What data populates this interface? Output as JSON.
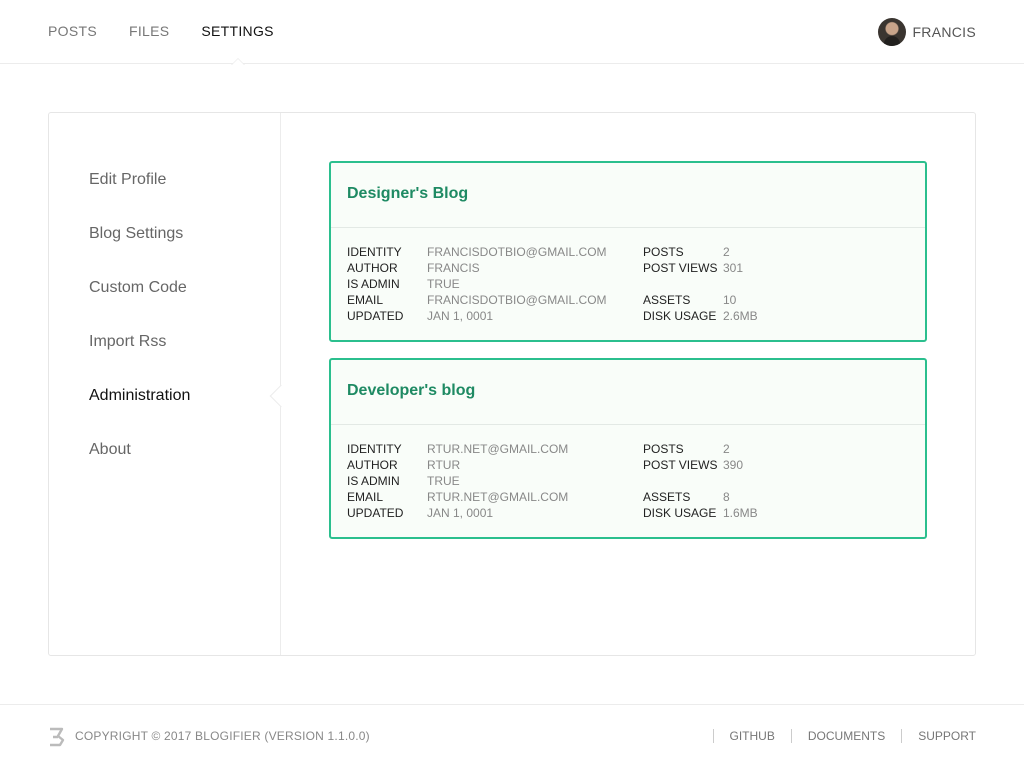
{
  "nav": {
    "items": [
      {
        "label": "POSTS"
      },
      {
        "label": "FILES"
      },
      {
        "label": "SETTINGS"
      }
    ],
    "active": "SETTINGS"
  },
  "user": {
    "name": "FRANCIS",
    "avatar_icon": "user-avatar-photo"
  },
  "sidebar": {
    "items": [
      {
        "label": "Edit Profile"
      },
      {
        "label": "Blog Settings"
      },
      {
        "label": "Custom Code"
      },
      {
        "label": "Import Rss"
      },
      {
        "label": "Administration"
      },
      {
        "label": "About"
      }
    ],
    "active": "Administration"
  },
  "blogs": [
    {
      "title": "Designer's Blog",
      "identity_label": "IDENTITY",
      "identity": "FRANCISDOTBIO@GMAIL.COM",
      "author_label": "AUTHOR",
      "author": "FRANCIS",
      "is_admin_label": "IS ADMIN",
      "is_admin": "TRUE",
      "email_label": "EMAIL",
      "email": "FRANCISDOTBIO@GMAIL.COM",
      "updated_label": "UPDATED",
      "updated": "JAN 1, 0001",
      "posts_label": "POSTS",
      "posts": "2",
      "post_views_label": "POST VIEWS",
      "post_views": "301",
      "assets_label": "ASSETS",
      "assets": "10",
      "disk_usage_label": "DISK USAGE",
      "disk_usage": "2.6MB"
    },
    {
      "title": "Developer's blog",
      "identity_label": "IDENTITY",
      "identity": "RTUR.NET@GMAIL.COM",
      "author_label": "AUTHOR",
      "author": "RTUR",
      "is_admin_label": "IS ADMIN",
      "is_admin": "TRUE",
      "email_label": "EMAIL",
      "email": "RTUR.NET@GMAIL.COM",
      "updated_label": "UPDATED",
      "updated": "JAN 1, 0001",
      "posts_label": "POSTS",
      "posts": "2",
      "post_views_label": "POST VIEWS",
      "post_views": "390",
      "assets_label": "ASSETS",
      "assets": "8",
      "disk_usage_label": "DISK USAGE",
      "disk_usage": "1.6MB"
    }
  ],
  "footer": {
    "logo_icon": "blogifier-logo-icon",
    "copyright": "COPYRIGHT © 2017 BLOGIFIER (VERSION 1.1.0.0)",
    "links": [
      {
        "label": "GITHUB"
      },
      {
        "label": "DOCUMENTS"
      },
      {
        "label": "SUPPORT"
      }
    ]
  },
  "colors": {
    "accent": "#2bbf8e",
    "title_green": "#1e8a63",
    "card_bg": "#f9fdf9"
  }
}
